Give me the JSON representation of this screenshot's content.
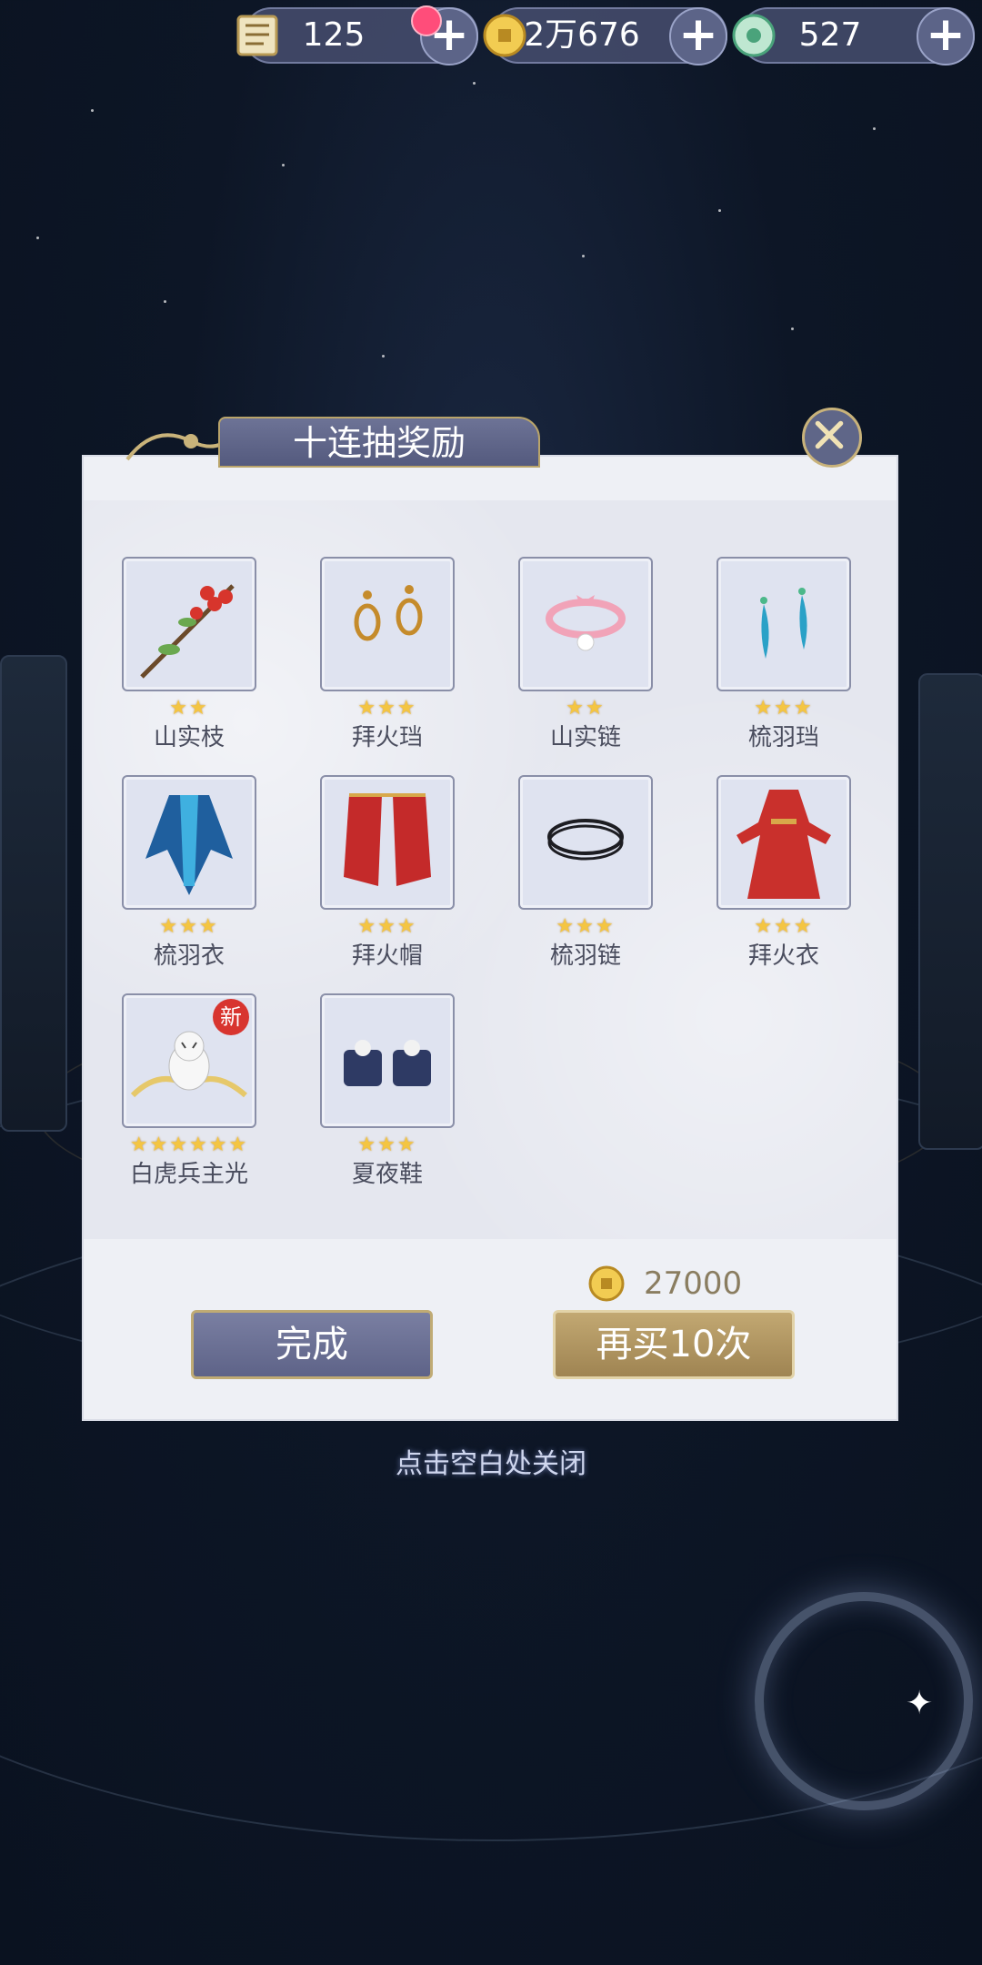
{
  "currency": [
    {
      "icon": "scroll-icon",
      "value": "125"
    },
    {
      "icon": "gold-coin-icon",
      "value": "2万676"
    },
    {
      "icon": "jade-icon",
      "value": "527"
    }
  ],
  "dialog": {
    "title": "十连抽奖励",
    "items": [
      {
        "name": "山实枝",
        "stars": "★★",
        "icon": "berry-branch-icon"
      },
      {
        "name": "拜火珰",
        "stars": "★★★",
        "icon": "gold-earrings-icon"
      },
      {
        "name": "山实链",
        "stars": "★★",
        "icon": "pink-choker-icon"
      },
      {
        "name": "梳羽珰",
        "stars": "★★★",
        "icon": "feather-earrings-icon"
      },
      {
        "name": "梳羽衣",
        "stars": "★★★",
        "icon": "feather-robe-icon"
      },
      {
        "name": "拜火帽",
        "stars": "★★★",
        "icon": "red-veil-icon"
      },
      {
        "name": "梳羽链",
        "stars": "★★★",
        "icon": "black-necklace-icon"
      },
      {
        "name": "拜火衣",
        "stars": "★★★",
        "icon": "red-dress-icon"
      },
      {
        "name": "白虎兵主光",
        "stars": "★★★★★★",
        "icon": "white-tiger-icon",
        "badge": "新"
      },
      {
        "name": "夏夜鞋",
        "stars": "★★★",
        "icon": "clogs-icon"
      }
    ],
    "cost": "27000",
    "done_label": "完成",
    "buy_again_label": "再买10次"
  },
  "hint": "点击空白处关闭"
}
